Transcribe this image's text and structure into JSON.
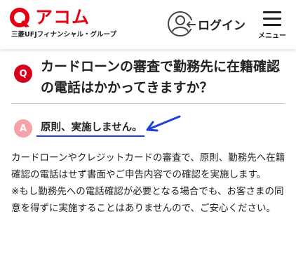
{
  "header": {
    "logo_text": "アコム",
    "logo_sub": "三菱UFJフィナンシャル・グループ",
    "login_label": "ログイン",
    "menu_label": "メニュー"
  },
  "colors": {
    "brand_red": "#e60012",
    "question_badge": "#d7001c",
    "answer_badge": "#f4a3a8",
    "annotation_blue": "#1f3fdc"
  },
  "faq": {
    "question_badge": "Q",
    "question": "カードローンの審査で勤務先に在籍確認の電話はかかってきますか？",
    "answer_badge": "A",
    "answer_summary": "原則、実施しません。",
    "answer_body_1": "カードローンやクレジットカードの審査で、原則、勤務先へ在籍確認の電話はせず書面やご申告内容での確認を実施します。",
    "answer_body_2": "※もし勤務先への電話確認が必要となる場合でも、お客さまの同意を得ずに実施することはありませんので、ご安心ください。"
  }
}
